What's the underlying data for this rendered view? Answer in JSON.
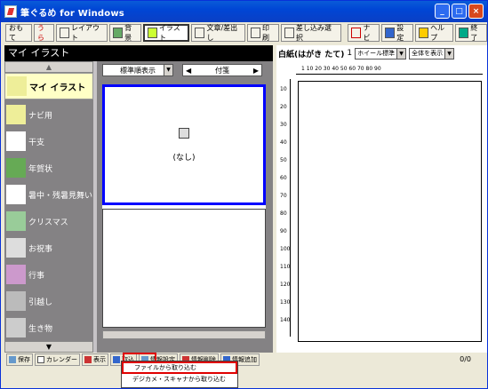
{
  "window": {
    "title": "筆ぐるめ for Windows",
    "min": "_",
    "max": "□",
    "close": "×"
  },
  "toolbar": {
    "items": [
      {
        "label": "おもて",
        "name": "omote"
      },
      {
        "label": "うら",
        "name": "ura"
      },
      {
        "label": "レイアウト",
        "name": "layout"
      },
      {
        "label": "背景",
        "name": "background"
      },
      {
        "label": "イラスト",
        "name": "illust"
      },
      {
        "label": "文章/差出し",
        "name": "text"
      },
      {
        "label": "印刷",
        "name": "print"
      },
      {
        "label": "差し込み選 択",
        "name": "merge"
      },
      {
        "label": "ナビ",
        "name": "navi"
      },
      {
        "label": "設定",
        "name": "settings"
      },
      {
        "label": "ヘルプ",
        "name": "help"
      },
      {
        "label": "終了",
        "name": "exit"
      }
    ]
  },
  "left": {
    "title": "マイ イラスト",
    "categories": [
      {
        "label": "マイ イラスト",
        "selected": true
      },
      {
        "label": "ナビ用"
      },
      {
        "label": "干支"
      },
      {
        "label": "年賀状"
      },
      {
        "label": "暑中・残暑見舞い"
      },
      {
        "label": "クリスマス"
      },
      {
        "label": "お祝事"
      },
      {
        "label": "行事"
      },
      {
        "label": "引越し"
      },
      {
        "label": "生き物"
      }
    ],
    "up": "▲",
    "down": "▼"
  },
  "middle": {
    "sort": "標準順表示",
    "nav_prev": "◀",
    "nav_label": "付箋",
    "nav_next": "▶",
    "thumb_label": "(なし)"
  },
  "right": {
    "paper": "白紙(はがき たて)",
    "pageno": "1",
    "wheel": "ホイール標準",
    "zoom": "全体を表示",
    "ruler_h": "1 10 20 30 40 50 60 70 80 90",
    "ruler_v": "10 20 30 40 50 60 70 80 90 100 110 120 130 140",
    "page_count": "0/0"
  },
  "bottom": {
    "save": "保存",
    "calendar": "カレンダー",
    "show": "表示",
    "import": "取込",
    "info_settings": "情報設定",
    "info_delete": "情報削除",
    "info_add": "情報追加"
  },
  "menu": {
    "items": [
      "ファイルから取り込む",
      "デジカメ・スキャナから取り込む"
    ]
  }
}
